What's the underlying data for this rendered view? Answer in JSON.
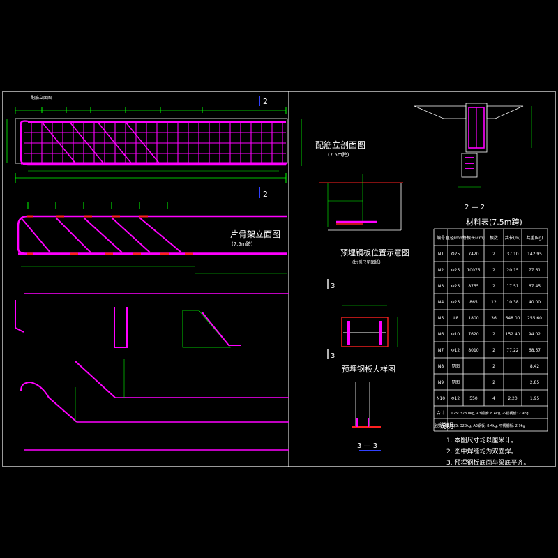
{
  "drawing": {
    "title_rib": "一片骨架立面图",
    "title_rib_scale": "(7.5m跨)",
    "title_section": "配筋立剖面图",
    "title_section_scale": "(7.5m跨)",
    "title_plate_pos": "预埋钢板位置示意图",
    "title_plate_pos_scale": "(比例尺见图纸)",
    "title_plate_detail": "预埋钢板大样图",
    "section_2_2": "2 — 2",
    "section_3_3": "3 — 3",
    "mark_2": "2",
    "mark_3": "3",
    "material_table_title": "材料表(7.5m跨)",
    "notes_title": "说明:",
    "notes": [
      "1. 本图尺寸均以厘米计。",
      "2. 图中焊缝均为双面焊。",
      "3. 预埋钢板底面与梁底平齐。"
    ]
  },
  "table": {
    "headers": [
      "编号",
      "直径(mm)",
      "每根长(cm)",
      "根数",
      "共长(m)",
      "共重(kg)"
    ],
    "rows": [
      [
        "N1",
        "Φ25",
        "7420",
        "2",
        "37.10",
        "142.95"
      ],
      [
        "N2",
        "Φ25",
        "10075",
        "2",
        "20.15",
        "77.61"
      ],
      [
        "N3",
        "Φ25",
        "8755",
        "2",
        "17.51",
        "67.45"
      ],
      [
        "N4",
        "Φ25",
        "865",
        "12",
        "10.38",
        "40.00"
      ],
      [
        "N5",
        "Φ8",
        "1800",
        "36",
        "648.00",
        "255.60"
      ],
      [
        "N6",
        "Φ10",
        "7620",
        "2",
        "152.40",
        "94.02"
      ],
      [
        "N7",
        "Φ12",
        "8010",
        "2",
        "77.22",
        "68.57"
      ],
      [
        "N8",
        "见图",
        "",
        "2",
        "",
        "8.42"
      ],
      [
        "N9",
        "见图",
        "",
        "2",
        "",
        "2.85"
      ],
      [
        "N10",
        "Φ12",
        "550",
        "4",
        "2.20",
        "1.95"
      ]
    ],
    "total_label": "合计",
    "total_text": "Φ25: 328.0kg, A3钢板: 8.4kg, 不锈钢板: 2.9kg",
    "grand_label": "全部合计",
    "grand_text": "Φ25: 328kg, A3钢板: 8.4kg, 不锈钢板: 2.9kg"
  }
}
